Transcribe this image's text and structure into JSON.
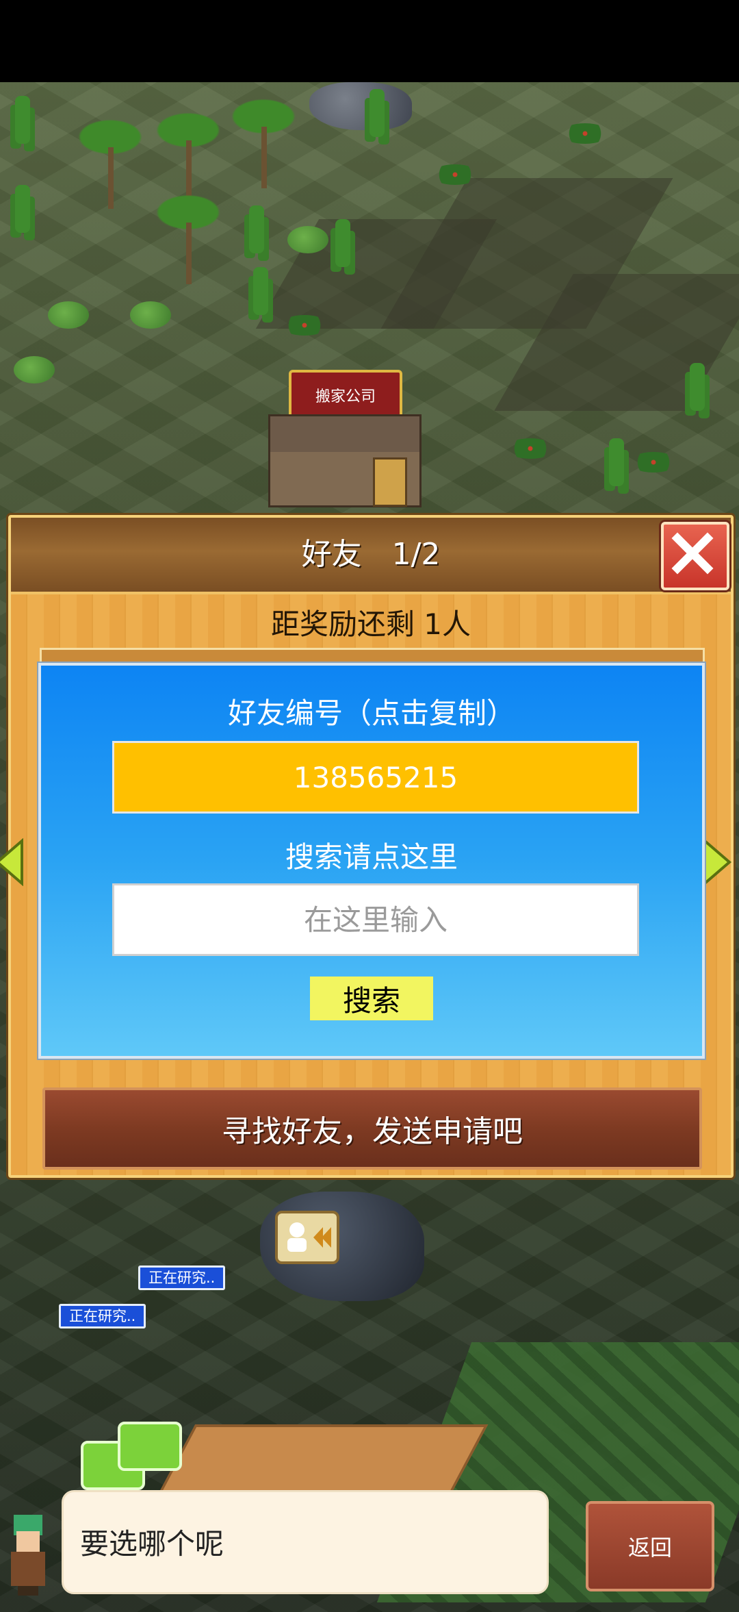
{
  "map": {
    "building_sign": "搬家公司",
    "research_labels": [
      "正在研究..",
      "正在研究.."
    ]
  },
  "dialog": {
    "title": "好友　1/2",
    "reward_text": "距奖励还剩 1人",
    "close_icon": "close-x-icon",
    "find_button": "寻找好友，发送申请吧"
  },
  "friend_panel": {
    "id_label": "好友编号（点击复制）",
    "friend_id": "138565215",
    "search_label": "搜索请点这里",
    "search_placeholder": "在这里输入",
    "search_button": "搜索"
  },
  "bottom": {
    "speech_text": "要选哪个呢",
    "back_button": "返回"
  },
  "colors": {
    "panel_blue": "#0d84f3",
    "id_box": "#ffc000",
    "search_button": "#f2f560",
    "close_red": "#c8342a",
    "dialog_gold": "#e9a544"
  }
}
